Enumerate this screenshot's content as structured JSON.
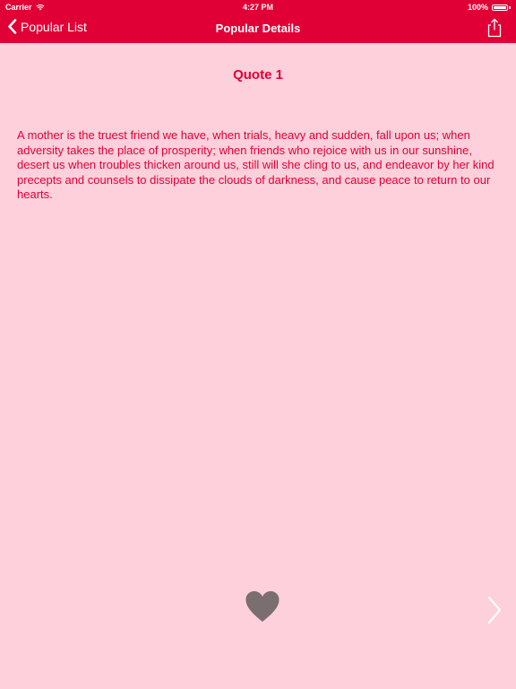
{
  "status_bar": {
    "carrier": "Carrier",
    "time": "4:27 PM",
    "battery": "100%"
  },
  "nav": {
    "back_label": "Popular List",
    "title": "Popular Details"
  },
  "quote": {
    "title": "Quote 1",
    "text": "A mother is the truest friend we have, when trials, heavy and sudden, fall upon us; when adversity takes the place of prosperity; when friends who rejoice with us in our sunshine, desert us when troubles thicken around us, still will she cling to us, and endeavor by her kind precepts and counsels to dissipate the clouds of darkness, and cause peace to return to our hearts."
  },
  "colors": {
    "header": "#e10035",
    "background": "#fdd0dc",
    "text": "#e10035",
    "heart": "#7a6e70",
    "chevron": "#ffffff"
  },
  "icons": {
    "back": "chevron-left-icon",
    "share": "share-icon",
    "favorite": "heart-icon",
    "next": "chevron-right-icon",
    "wifi": "wifi-icon",
    "battery": "battery-icon"
  }
}
